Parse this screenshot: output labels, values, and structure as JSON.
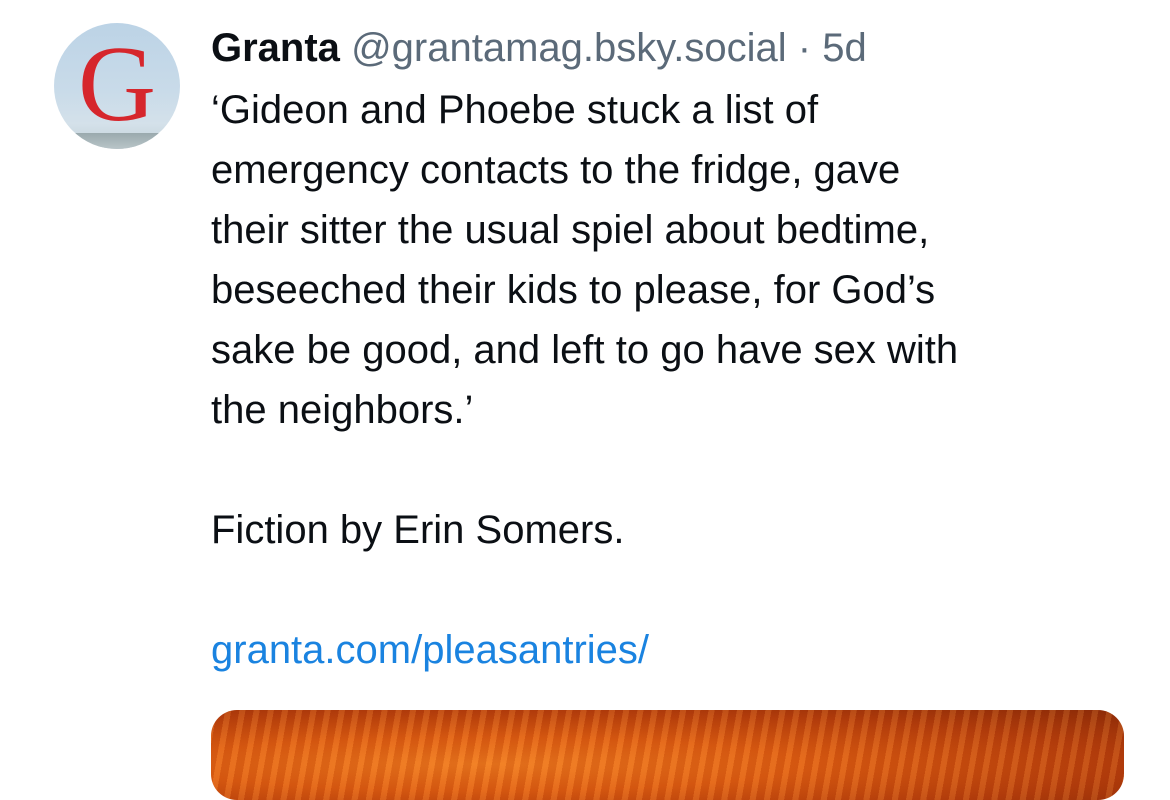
{
  "post": {
    "avatar": {
      "letter": "G",
      "letter_color": "#d6262c"
    },
    "author": {
      "display_name": "Granta",
      "handle": "@grantamag.bsky.social",
      "separator": "·",
      "timestamp": "5d"
    },
    "text": {
      "quote": "‘Gideon and Phoebe stuck a list of\nemergency contacts to the fridge, gave\ntheir sitter the usual spiel about bedtime,\nbeseeched their kids to please, for God’s\nsake be good, and left to go have sex with\nthe neighbors.’",
      "byline": "Fiction by Erin Somers.",
      "link": "granta.com/pleasantries/"
    },
    "colors": {
      "link": "#1a83e0",
      "secondary_text": "#5b6a79",
      "primary_text": "#0b0f14",
      "embed_accent": "#e05e12"
    }
  }
}
